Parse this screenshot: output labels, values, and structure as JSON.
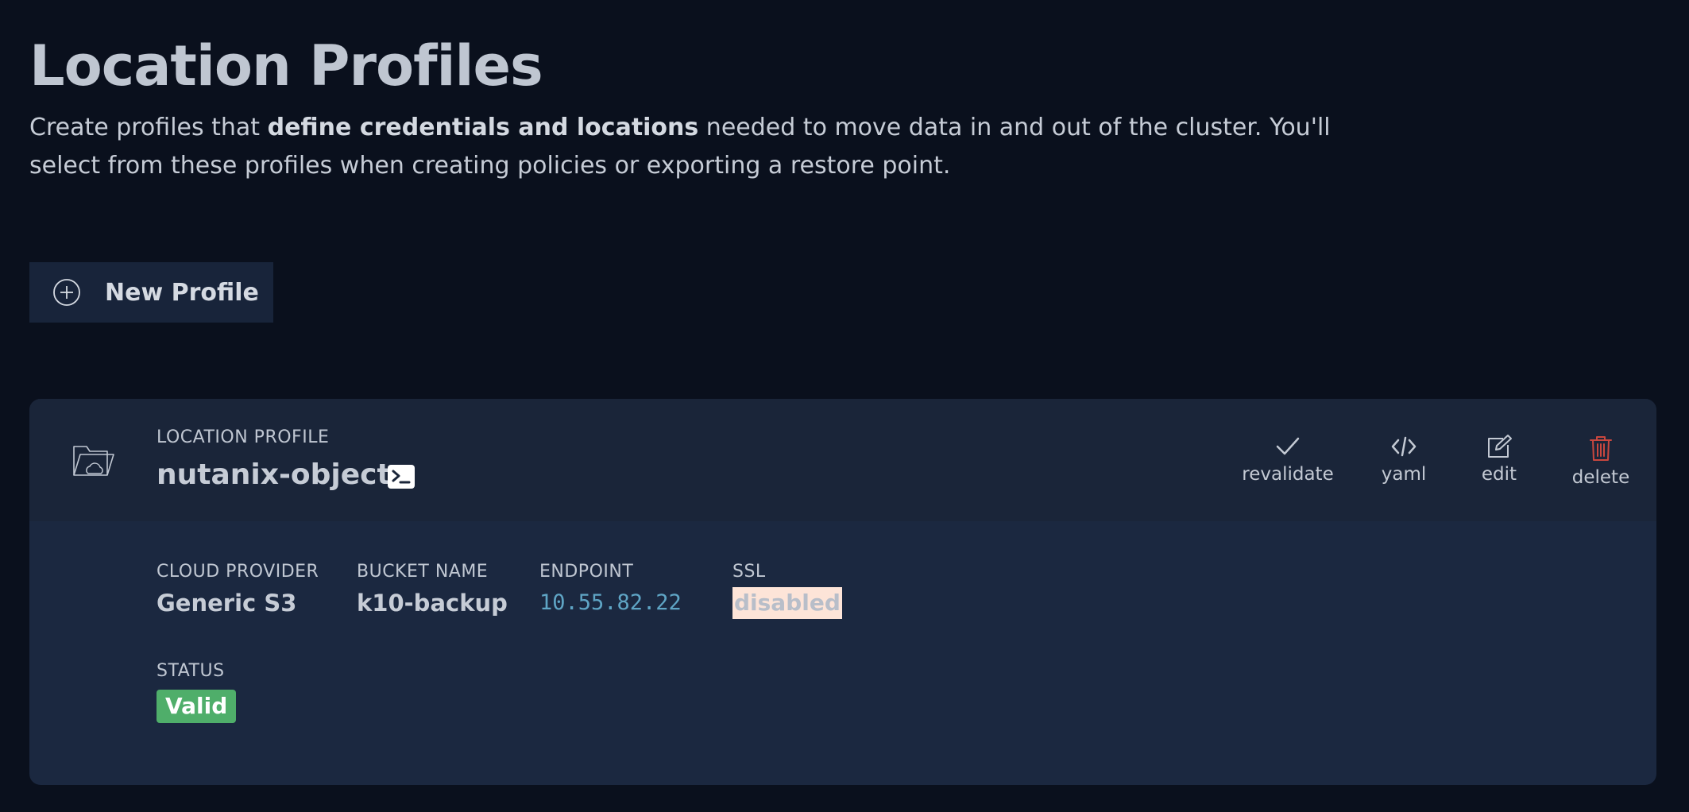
{
  "page": {
    "title": "Location Profiles",
    "description": {
      "before": "Create profiles that ",
      "emphasis": "define credentials and locations",
      "after": " needed to move data in and out of the cluster. You'll select from these profiles when creating policies or exporting a restore point."
    }
  },
  "toolbar": {
    "new_profile_label": "New Profile",
    "new_profile_icon": "plus-circle-icon"
  },
  "profile_card": {
    "type_label": "LOCATION PROFILE",
    "name": "nutanix-object",
    "icon": "folder-cloud-icon",
    "terminal_icon": "terminal-icon",
    "actions": [
      {
        "label": "revalidate",
        "icon": "check-icon"
      },
      {
        "label": "yaml",
        "icon": "code-icon"
      },
      {
        "label": "edit",
        "icon": "edit-icon"
      },
      {
        "label": "delete",
        "icon": "trash-icon",
        "color": "#c9473f"
      }
    ],
    "fields": {
      "cloud_provider": {
        "label": "CLOUD PROVIDER",
        "value": "Generic S3"
      },
      "bucket_name": {
        "label": "BUCKET NAME",
        "value": "k10-backup"
      },
      "endpoint": {
        "label": "ENDPOINT",
        "value": "10.55.82.22"
      },
      "ssl": {
        "label": "SSL",
        "value": "disabled"
      },
      "status": {
        "label": "STATUS",
        "value": "Valid",
        "color": "#4fae6a"
      }
    }
  }
}
